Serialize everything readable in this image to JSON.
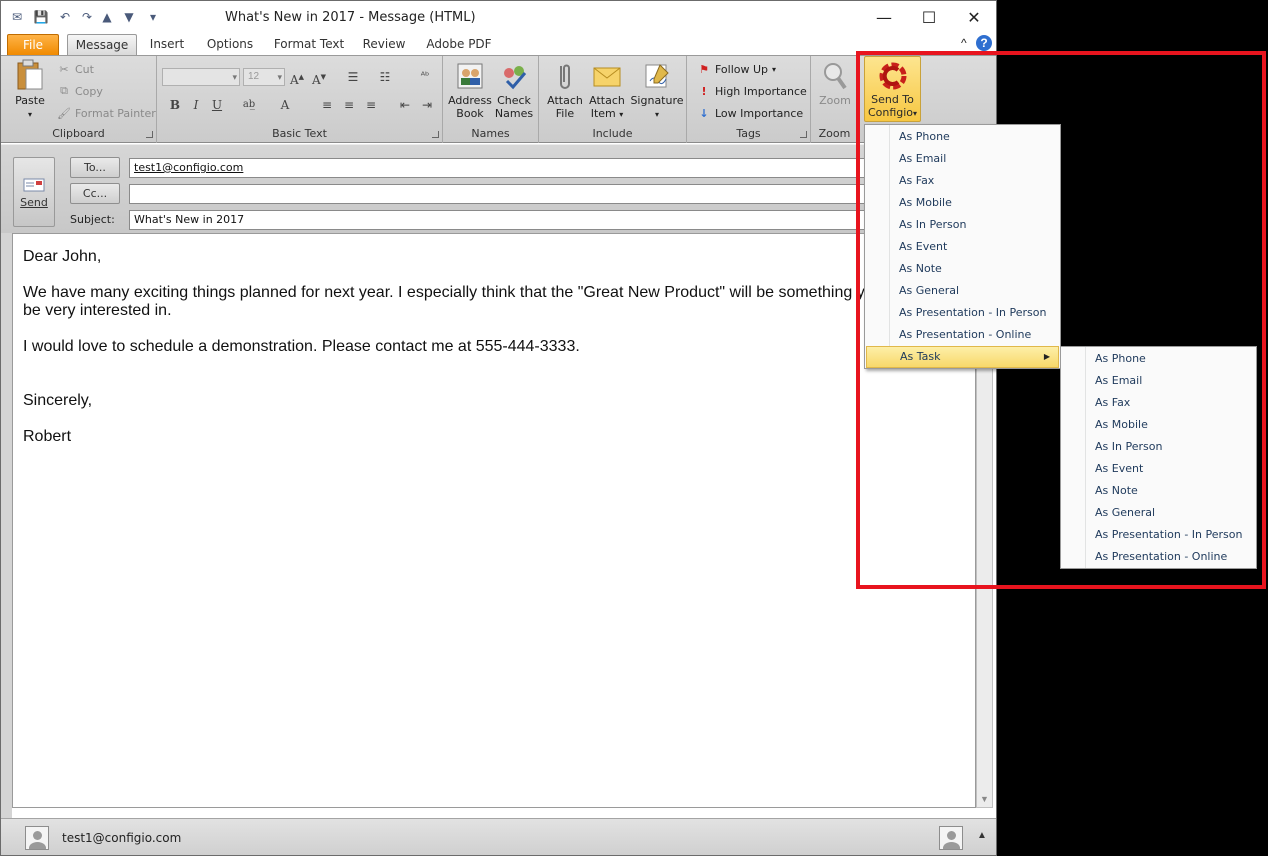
{
  "window": {
    "title": "What's New in 2017  -  Message (HTML)",
    "controls": {
      "minimize": "—",
      "maximize": "☐",
      "close": "✕"
    }
  },
  "tabs": [
    "File",
    "Message",
    "Insert",
    "Options",
    "Format Text",
    "Review",
    "Adobe PDF"
  ],
  "ribbon": {
    "clipboard": {
      "label": "Clipboard",
      "paste": "Paste",
      "cut": "Cut",
      "copy": "Copy",
      "format_painter": "Format Painter"
    },
    "basic_text": {
      "label": "Basic Text",
      "font_size": "12",
      "bold": "B",
      "italic": "I",
      "underline": "U"
    },
    "names": {
      "label": "Names",
      "address_book": "Address Book",
      "check_names": "Check Names"
    },
    "include": {
      "label": "Include",
      "attach_file": "Attach File",
      "attach_item": "Attach Item",
      "signature": "Signature"
    },
    "tags": {
      "label": "Tags",
      "follow_up": "Follow Up",
      "high_importance": "High Importance",
      "low_importance": "Low Importance"
    },
    "zoom": {
      "label": "Zoom",
      "zoom": "Zoom"
    },
    "configio": {
      "line1": "Send To",
      "line2": "Configio"
    }
  },
  "header": {
    "send": "Send",
    "to_button": "To...",
    "cc_button": "Cc...",
    "subject_label": "Subject:",
    "to_value": "test1@configio.com",
    "cc_value": "",
    "subject_value": "What's New in 2017"
  },
  "body": {
    "greeting": "Dear John,",
    "paragraph1_line1": "We have many exciting things planned for next year. I especially think that the \"Great New Product\" will be something you will",
    "paragraph1_line2": "be very interested in.",
    "paragraph2": "I would love to schedule a demonstration. Please contact me at 555-444-3333.",
    "closing": "Sincerely,",
    "signature": "Robert"
  },
  "status_bar": {
    "email": "test1@configio.com"
  },
  "configio_menu": {
    "items": [
      "As Phone",
      "As Email",
      "As Fax",
      "As Mobile",
      "As In Person",
      "As Event",
      "As Note",
      "As General",
      "As Presentation - In Person",
      "As Presentation - Online",
      "As Task"
    ],
    "highlighted": "As Task"
  },
  "task_submenu": {
    "items": [
      "As Phone",
      "As Email",
      "As Fax",
      "As Mobile",
      "As In Person",
      "As Event",
      "As Note",
      "As General",
      "As Presentation - In Person",
      "As Presentation - Online"
    ]
  },
  "colors": {
    "highlight_box": "#e8141e",
    "file_tab": "#f08a00",
    "configio_button": "#f7c742"
  }
}
